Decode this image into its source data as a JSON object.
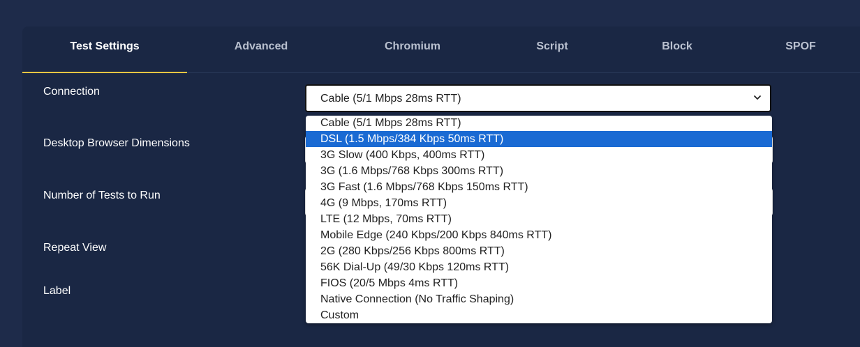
{
  "tabs": [
    {
      "label": "Test Settings",
      "active": true
    },
    {
      "label": "Advanced",
      "active": false
    },
    {
      "label": "Chromium",
      "active": false
    },
    {
      "label": "Script",
      "active": false
    },
    {
      "label": "Block",
      "active": false
    },
    {
      "label": "SPOF",
      "active": false
    }
  ],
  "form": {
    "connection_label": "Connection",
    "desktop_dimensions_label": "Desktop Browser Dimensions",
    "num_tests_label": "Number of Tests to Run",
    "repeat_view_label": "Repeat View",
    "label_label": "Label"
  },
  "connection_select": {
    "selected_value": "Cable (5/1 Mbps 28ms RTT)",
    "highlighted_option": "DSL (1.5 Mbps/384 Kbps 50ms RTT)",
    "options": [
      "Cable (5/1 Mbps 28ms RTT)",
      "DSL (1.5 Mbps/384 Kbps 50ms RTT)",
      "3G Slow (400 Kbps, 400ms RTT)",
      "3G (1.6 Mbps/768 Kbps 300ms RTT)",
      "3G Fast (1.6 Mbps/768 Kbps 150ms RTT)",
      "4G (9 Mbps, 170ms RTT)",
      "LTE (12 Mbps, 70ms RTT)",
      "Mobile Edge (240 Kbps/200 Kbps 840ms RTT)",
      "2G (280 Kbps/256 Kbps 800ms RTT)",
      "56K Dial-Up (49/30 Kbps 120ms RTT)",
      "FIOS (20/5 Mbps 4ms RTT)",
      "Native Connection (No Traffic Shaping)",
      "Custom"
    ]
  },
  "colors": {
    "background": "#1e2b4a",
    "panel": "#1a2744",
    "active_tab_underline": "#f5c542",
    "option_highlight": "#1a6ad3"
  },
  "icons": {
    "select_chevron": "chevron-down-icon"
  }
}
